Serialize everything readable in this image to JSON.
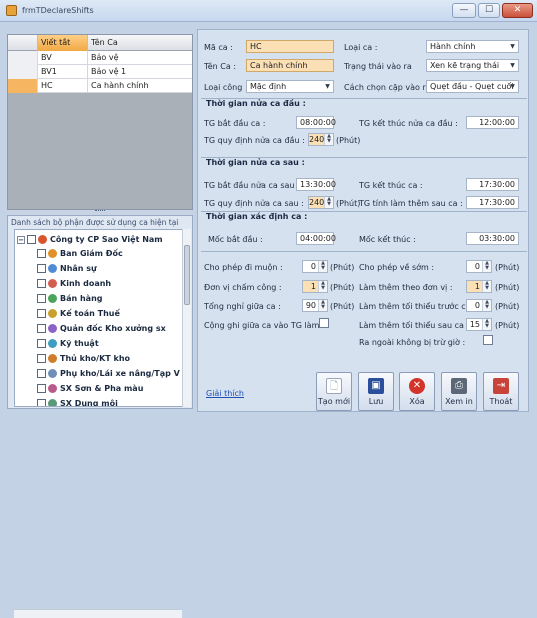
{
  "window": {
    "title": "frmTDeclareShifts",
    "minimize_glyph": "—",
    "maximize_glyph": "☐",
    "close_glyph": "✕"
  },
  "grid": {
    "columns": [
      "Viết tắt",
      "Tên Ca"
    ],
    "rows": [
      {
        "code": "BV",
        "name": "Bảo vệ",
        "selected": false
      },
      {
        "code": "BV1",
        "name": "Bảo vệ 1",
        "selected": false
      },
      {
        "code": "HC",
        "name": "Ca hành chính",
        "selected": true
      }
    ]
  },
  "tree": {
    "caption": "Danh sách bộ phận được sử dụng ca hiện tại",
    "root": "Công ty CP Sao Việt Nam",
    "items": [
      "Ban Giám Đốc",
      "Nhân sự",
      "Kinh doanh",
      "Bán hàng",
      "Kế toán Thuế",
      "Quản đốc Kho xưởng sx",
      "Kỹ thuật",
      "Thủ kho/KT kho",
      "Phụ kho/Lái xe nâng/Tạp V",
      "SX Sơn & Pha màu",
      "SX Dung môi"
    ]
  },
  "form": {
    "ma_ca_label": "Mã ca :",
    "ma_ca_value": "HC",
    "ten_ca_label": "Tên Ca :",
    "ten_ca_value": "Ca hành chính",
    "loai_cong_label": "Loại công",
    "loai_cong_value": "Mặc định",
    "loai_ca_label": "Loại ca :",
    "loai_ca_value": "Hành chính",
    "trang_thai_label": "Trạng thái vào ra",
    "trang_thai_value": "Xen kẽ trạng thái",
    "cach_chon_label": "Cách chọn cặp vào ra",
    "cach_chon_value": "Quẹt đầu - Quẹt cuối"
  },
  "section1": {
    "title": "Thời gian nửa ca đầu :",
    "start_label": "TG bắt đầu ca :",
    "start_value": "08:00:00",
    "end_label": "TG kết thúc nửa ca đầu :",
    "end_value": "12:00:00",
    "quota_label": "TG quy định nửa ca đầu :",
    "quota_value": "240",
    "quota_unit": "(Phút)"
  },
  "section2": {
    "title": "Thời gian nửa ca sau :",
    "start_label": "TG bắt đầu nửa ca sau :",
    "start_value": "13:30:00",
    "end_label": "TG kết thúc ca :",
    "end_value": "17:30:00",
    "quota_label": "TG quy định nửa ca sau :",
    "quota_value": "240",
    "quota_unit": "(Phút)",
    "ot_label": "TG tính làm thêm sau ca :",
    "ot_value": "17:30:00"
  },
  "section3": {
    "title": "Thời gian xác định ca :",
    "from_label": "Mốc bắt đầu :",
    "from_value": "04:00:00",
    "to_label": "Mốc kết thúc :",
    "to_value": "03:30:00"
  },
  "rules": {
    "late_label": "Cho phép đi muộn :",
    "late_value": "0",
    "early_label": "Cho phép về sớm :",
    "early_value": "0",
    "unit_label": "Đơn vị chấm công :",
    "unit_value": "1",
    "ot_unit_label": "Làm thêm theo đơn vị :",
    "ot_unit_value": "1",
    "break_label": "Tổng nghỉ giữa ca :",
    "break_value": "90",
    "ot_min_before_label": "Làm thêm tối thiểu trước ca :",
    "ot_min_before_value": "0",
    "add_break_label": "Cộng ghi giữa ca vào TG làm :",
    "ot_min_after_label": "Làm thêm tối thiểu sau ca :",
    "ot_min_after_value": "15",
    "no_deduct_label": "Ra ngoài không bị trừ giờ :",
    "minute_unit": "(Phút)"
  },
  "footer": {
    "help_link": "Giải thích",
    "buttons": [
      {
        "label": "Tạo mới",
        "icon": "new-document-icon"
      },
      {
        "label": "Lưu",
        "icon": "save-disk-icon"
      },
      {
        "label": "Xóa",
        "icon": "delete-icon"
      },
      {
        "label": "Xem in",
        "icon": "print-preview-icon"
      },
      {
        "label": "Thoát",
        "icon": "exit-door-icon"
      }
    ]
  },
  "colors": {
    "highlight_input": "#fbe0b6",
    "selected_row_indicator": "#f6b560",
    "link": "#1f4fb5"
  }
}
